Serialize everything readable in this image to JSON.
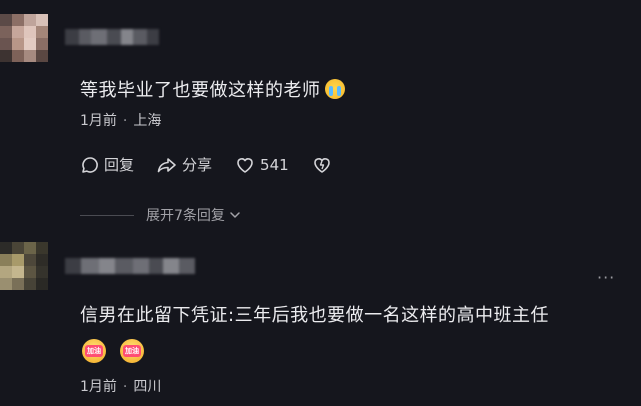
{
  "comments": [
    {
      "text": "等我毕业了也要做这样的老师",
      "emoji": "loudly-crying-face",
      "time": "1月前",
      "location": "上海",
      "actions": {
        "reply": "回复",
        "share": "分享",
        "likes": "541"
      },
      "expand_label": "展开7条回复"
    },
    {
      "text": "信男在此留下凭证:三年后我也要做一名这样的高中班主任",
      "stickers": [
        "加油",
        "加油"
      ],
      "time": "1月前",
      "location": "四川",
      "more": "···"
    }
  ],
  "colors": {
    "background": "#15161d",
    "text": "#ececef",
    "meta": "#c9c9ce",
    "muted": "#a2a2a8"
  }
}
